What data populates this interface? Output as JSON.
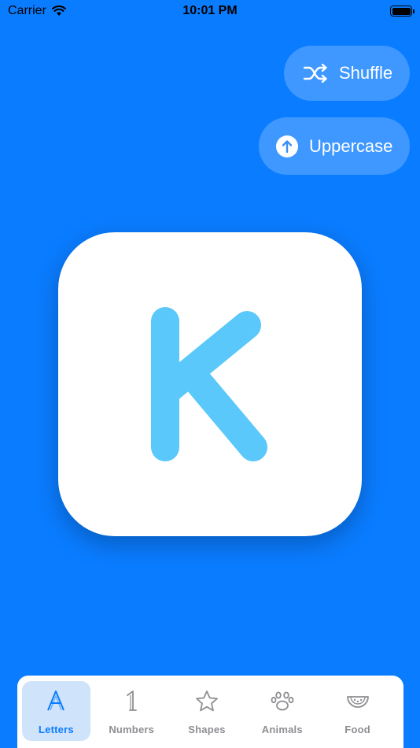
{
  "status_bar": {
    "carrier": "Carrier",
    "time": "10:01 PM"
  },
  "controls": {
    "shuffle_label": "Shuffle",
    "case_label": "Uppercase"
  },
  "card": {
    "letter": "K",
    "letter_color": "#5ac8fa"
  },
  "tabs": [
    {
      "label": "Letters",
      "icon": "letter-a-icon",
      "active": true
    },
    {
      "label": "Numbers",
      "icon": "number-one-icon",
      "active": false
    },
    {
      "label": "Shapes",
      "icon": "star-icon",
      "active": false
    },
    {
      "label": "Animals",
      "icon": "paw-icon",
      "active": false
    },
    {
      "label": "Food",
      "icon": "watermelon-slice-icon",
      "active": false
    }
  ],
  "colors": {
    "background": "#0a7cff",
    "accent": "#0a7cff",
    "tab_inactive": "#8e8e93"
  }
}
